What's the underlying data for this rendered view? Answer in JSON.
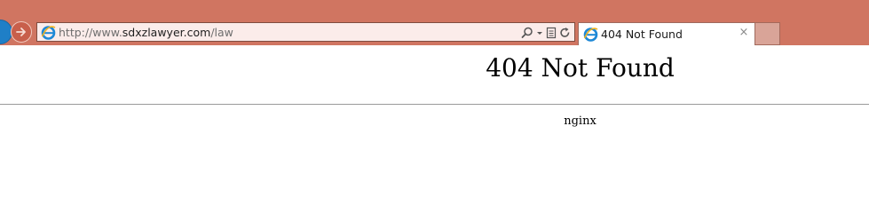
{
  "browser": {
    "address_bar": {
      "url_prefix": "http://www.",
      "url_domain": "sdxzlawyer.com",
      "url_path": "/law",
      "icon": "ie-logo-icon",
      "tools": [
        "search-icon",
        "dropdown-arrow-icon",
        "compatibility-view-icon",
        "refresh-icon"
      ]
    },
    "tab": {
      "title": "404 Not Found",
      "icon": "ie-logo-icon",
      "close_label": "×"
    },
    "colors": {
      "chrome": "#d07561",
      "address_bar": "#fbecea",
      "back_button": "#1f7fc7"
    }
  },
  "page": {
    "heading": "404 Not Found",
    "server_signature": "nginx"
  }
}
